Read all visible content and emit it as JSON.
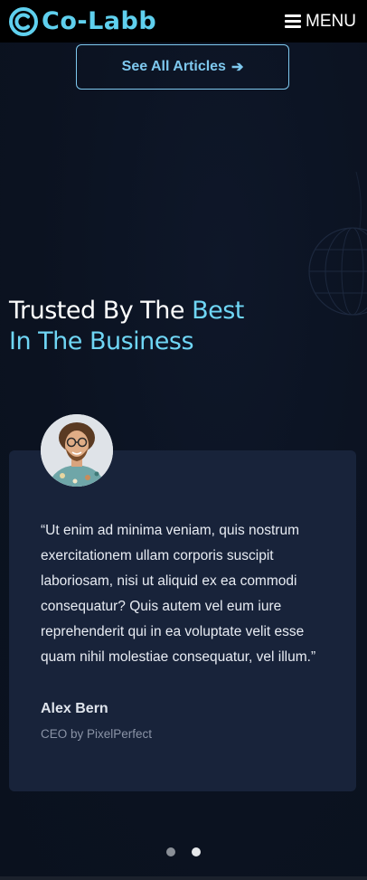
{
  "header": {
    "logo_text": "Co-Labb",
    "menu_label": "MENU",
    "brand_color": "#5fd0ee"
  },
  "articles": {
    "see_all_label": "See All Articles",
    "arrow_icon": "arrow-right-icon"
  },
  "section": {
    "title_part1": "Trusted By The ",
    "title_highlight_1": "Best",
    "title_highlight_2": "In The Business",
    "accent_color": "#6fd6f5"
  },
  "testimonial": {
    "quote": "“Ut enim ad minima veniam, quis nostrum exercitationem ullam corporis suscipit laboriosam, nisi ut aliquid ex ea commodi consequatur? Quis autem vel eum iure reprehenderit qui in ea voluptate velit esse quam nihil molestiae consequatur, vel illum.”",
    "author_name": "Alex Bern",
    "author_role": "CEO by PixelPerfect"
  },
  "carousel": {
    "slide_count": 2,
    "active_index": 1
  }
}
